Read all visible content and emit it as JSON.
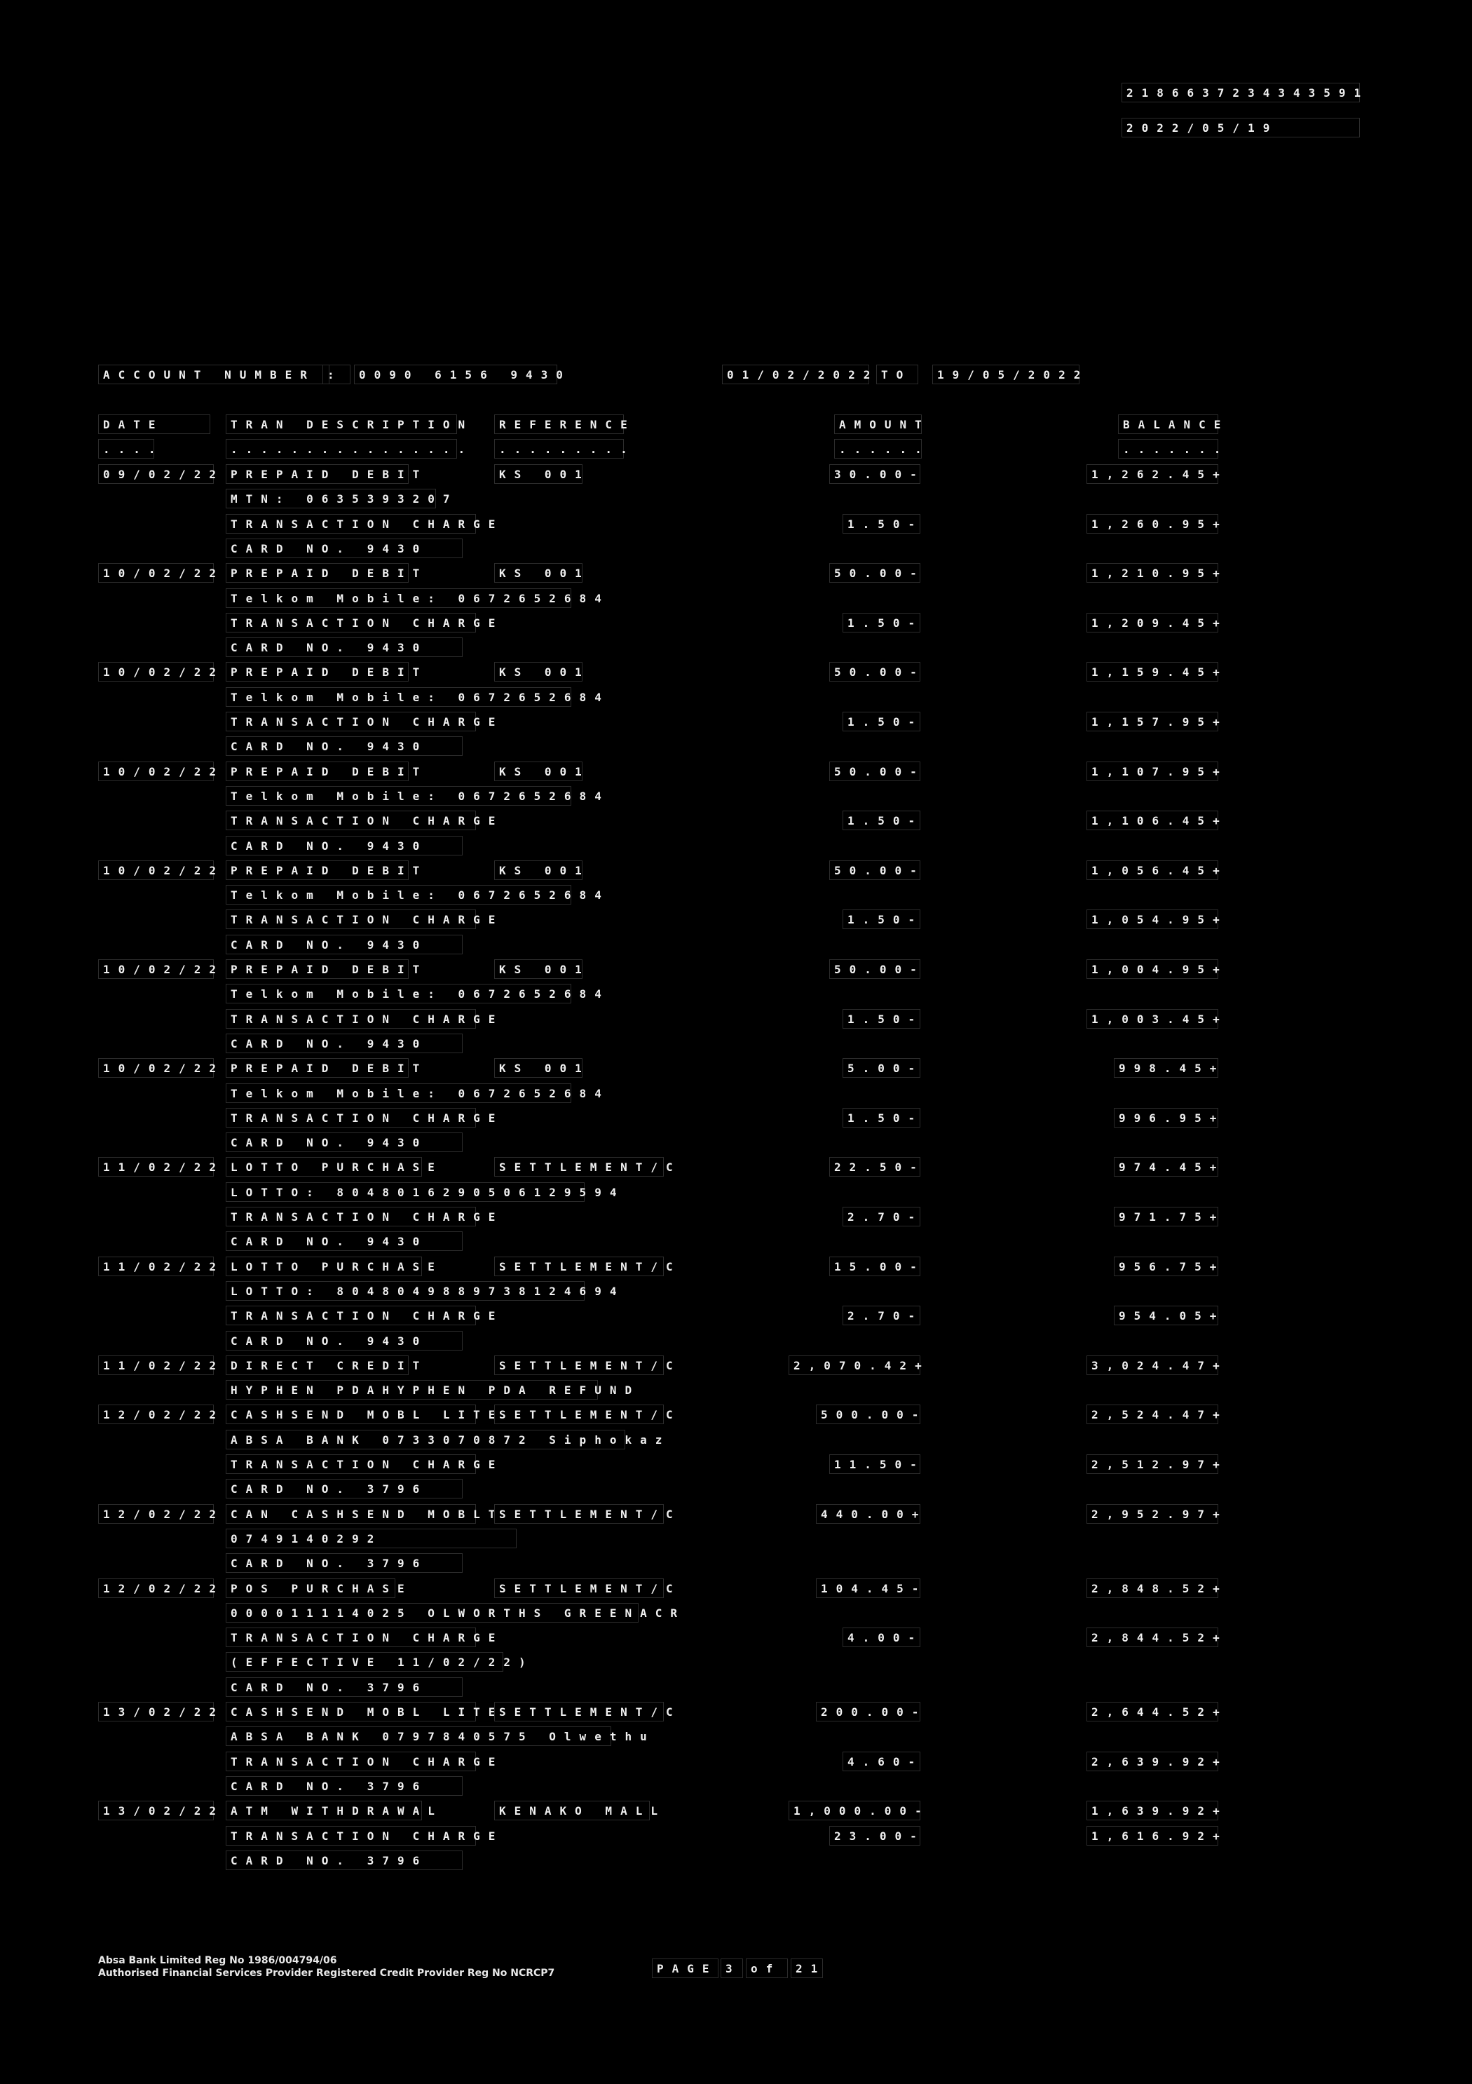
{
  "header": {
    "reference_number": "2186637234343591",
    "statement_date": "2022/05/19"
  },
  "account": {
    "label": "ACCOUNT NUMBER",
    "separator": ":",
    "number": "0090 6156 9430",
    "period_from": "01/02/2022",
    "period_to_label": "TO",
    "period_to": "19/05/2022"
  },
  "columns": {
    "date": "DATE",
    "description": "TRAN DESCRIPTION",
    "reference": "REFERENCE",
    "amount": "AMOUNT",
    "balance": "BALANCE",
    "date_underline": "....",
    "description_underline": "................",
    "reference_underline": ".........",
    "amount_underline": "......",
    "balance_underline": "......."
  },
  "rows": [
    {
      "date": "09/02/22",
      "desc": "PREPAID DEBIT",
      "ref": "KS 001",
      "amount": "30.00-",
      "balance": "1,262.45+"
    },
    {
      "date": "",
      "desc": "MTN: 0635393207",
      "ref": "",
      "amount": "",
      "balance": ""
    },
    {
      "date": "",
      "desc": "TRANSACTION CHARGE",
      "ref": "",
      "amount": "1.50-",
      "balance": "1,260.95+"
    },
    {
      "date": "",
      "desc": "CARD NO.     9430",
      "ref": "",
      "amount": "",
      "balance": ""
    },
    {
      "date": "10/02/22",
      "desc": "PREPAID DEBIT",
      "ref": "KS 001",
      "amount": "50.00-",
      "balance": "1,210.95+"
    },
    {
      "date": "",
      "desc": "Telkom Mobile: 0672652684",
      "ref": "",
      "amount": "",
      "balance": ""
    },
    {
      "date": "",
      "desc": "TRANSACTION CHARGE",
      "ref": "",
      "amount": "1.50-",
      "balance": "1,209.45+"
    },
    {
      "date": "",
      "desc": "CARD NO.     9430",
      "ref": "",
      "amount": "",
      "balance": ""
    },
    {
      "date": "10/02/22",
      "desc": "PREPAID DEBIT",
      "ref": "KS 001",
      "amount": "50.00-",
      "balance": "1,159.45+"
    },
    {
      "date": "",
      "desc": "Telkom Mobile: 0672652684",
      "ref": "",
      "amount": "",
      "balance": ""
    },
    {
      "date": "",
      "desc": "TRANSACTION CHARGE",
      "ref": "",
      "amount": "1.50-",
      "balance": "1,157.95+"
    },
    {
      "date": "",
      "desc": "CARD NO.     9430",
      "ref": "",
      "amount": "",
      "balance": ""
    },
    {
      "date": "10/02/22",
      "desc": "PREPAID DEBIT",
      "ref": "KS 001",
      "amount": "50.00-",
      "balance": "1,107.95+"
    },
    {
      "date": "",
      "desc": "Telkom Mobile: 0672652684",
      "ref": "",
      "amount": "",
      "balance": ""
    },
    {
      "date": "",
      "desc": "TRANSACTION CHARGE",
      "ref": "",
      "amount": "1.50-",
      "balance": "1,106.45+"
    },
    {
      "date": "",
      "desc": "CARD NO.     9430",
      "ref": "",
      "amount": "",
      "balance": ""
    },
    {
      "date": "10/02/22",
      "desc": "PREPAID DEBIT",
      "ref": "KS 001",
      "amount": "50.00-",
      "balance": "1,056.45+"
    },
    {
      "date": "",
      "desc": "Telkom Mobile: 0672652684",
      "ref": "",
      "amount": "",
      "balance": ""
    },
    {
      "date": "",
      "desc": "TRANSACTION CHARGE",
      "ref": "",
      "amount": "1.50-",
      "balance": "1,054.95+"
    },
    {
      "date": "",
      "desc": "CARD NO.     9430",
      "ref": "",
      "amount": "",
      "balance": ""
    },
    {
      "date": "10/02/22",
      "desc": "PREPAID DEBIT",
      "ref": "KS 001",
      "amount": "50.00-",
      "balance": "1,004.95+"
    },
    {
      "date": "",
      "desc": "Telkom Mobile: 0672652684",
      "ref": "",
      "amount": "",
      "balance": ""
    },
    {
      "date": "",
      "desc": "TRANSACTION CHARGE",
      "ref": "",
      "amount": "1.50-",
      "balance": "1,003.45+"
    },
    {
      "date": "",
      "desc": "CARD NO.     9430",
      "ref": "",
      "amount": "",
      "balance": ""
    },
    {
      "date": "10/02/22",
      "desc": "PREPAID DEBIT",
      "ref": "KS 001",
      "amount": "5.00-",
      "balance": "998.45+"
    },
    {
      "date": "",
      "desc": "Telkom Mobile: 0672652684",
      "ref": "",
      "amount": "",
      "balance": ""
    },
    {
      "date": "",
      "desc": "TRANSACTION CHARGE",
      "ref": "",
      "amount": "1.50-",
      "balance": "996.95+"
    },
    {
      "date": "",
      "desc": "CARD NO.     9430",
      "ref": "",
      "amount": "",
      "balance": ""
    },
    {
      "date": "11/02/22",
      "desc": "LOTTO PURCHASE",
      "ref": "SETTLEMENT/C",
      "amount": "22.50-",
      "balance": "974.45+"
    },
    {
      "date": "",
      "desc": "LOTTO: 8048016290506129594",
      "ref": "",
      "amount": "",
      "balance": ""
    },
    {
      "date": "",
      "desc": "TRANSACTION CHARGE",
      "ref": "",
      "amount": "2.70-",
      "balance": "971.75+"
    },
    {
      "date": "",
      "desc": "CARD NO.     9430",
      "ref": "",
      "amount": "",
      "balance": ""
    },
    {
      "date": "11/02/22",
      "desc": "LOTTO PURCHASE",
      "ref": "SETTLEMENT/C",
      "amount": "15.00-",
      "balance": "956.75+"
    },
    {
      "date": "",
      "desc": "LOTTO: 8048049889738124694",
      "ref": "",
      "amount": "",
      "balance": ""
    },
    {
      "date": "",
      "desc": "TRANSACTION CHARGE",
      "ref": "",
      "amount": "2.70-",
      "balance": "954.05+"
    },
    {
      "date": "",
      "desc": "CARD NO.     9430",
      "ref": "",
      "amount": "",
      "balance": ""
    },
    {
      "date": "11/02/22",
      "desc": "DIRECT CREDIT",
      "ref": "SETTLEMENT/C",
      "amount": "2,070.42+",
      "balance": "3,024.47+"
    },
    {
      "date": "",
      "desc": "HYPHEN PDAHYPHEN PDA REFUND",
      "ref": "",
      "amount": "",
      "balance": ""
    },
    {
      "date": "12/02/22",
      "desc": "CASHSEND MOBL LITE",
      "ref": "SETTLEMENT/C",
      "amount": "500.00-",
      "balance": "2,524.47+"
    },
    {
      "date": "",
      "desc": "ABSA BANK 0733070872 Siphokaz",
      "ref": "",
      "amount": "",
      "balance": ""
    },
    {
      "date": "",
      "desc": "TRANSACTION CHARGE",
      "ref": "",
      "amount": "11.50-",
      "balance": "2,512.97+"
    },
    {
      "date": "",
      "desc": "CARD NO.     3796",
      "ref": "",
      "amount": "",
      "balance": ""
    },
    {
      "date": "12/02/22",
      "desc": "CAN CASHSEND MOBLT",
      "ref": "SETTLEMENT/C",
      "amount": "440.00+",
      "balance": "2,952.97+"
    },
    {
      "date": "",
      "desc": "           0749140292",
      "ref": "",
      "amount": "",
      "balance": ""
    },
    {
      "date": "",
      "desc": "CARD NO.     3796",
      "ref": "",
      "amount": "",
      "balance": ""
    },
    {
      "date": "12/02/22",
      "desc": "POS PURCHASE",
      "ref": "SETTLEMENT/C",
      "amount": "104.45-",
      "balance": "2,848.52+"
    },
    {
      "date": "",
      "desc": "000011114025 OLWORTHS GREENACR",
      "ref": "",
      "amount": "",
      "balance": ""
    },
    {
      "date": "",
      "desc": "TRANSACTION CHARGE",
      "ref": "",
      "amount": "4.00-",
      "balance": "2,844.52+"
    },
    {
      "date": "",
      "desc": "(EFFECTIVE 11/02/22)",
      "ref": "",
      "amount": "",
      "balance": ""
    },
    {
      "date": "",
      "desc": "CARD NO.     3796",
      "ref": "",
      "amount": "",
      "balance": ""
    },
    {
      "date": "13/02/22",
      "desc": "CASHSEND MOBL LITE",
      "ref": "SETTLEMENT/C",
      "amount": "200.00-",
      "balance": "2,644.52+"
    },
    {
      "date": "",
      "desc": "ABSA BANK 0797840575 Olwethu",
      "ref": "",
      "amount": "",
      "balance": ""
    },
    {
      "date": "",
      "desc": "TRANSACTION CHARGE",
      "ref": "",
      "amount": "4.60-",
      "balance": "2,639.92+"
    },
    {
      "date": "",
      "desc": "CARD NO.     3796",
      "ref": "",
      "amount": "",
      "balance": ""
    },
    {
      "date": "13/02/22",
      "desc": "ATM WITHDRAWAL",
      "ref": "KENAKO MALL",
      "amount": "1,000.00-",
      "balance": "1,639.92+"
    },
    {
      "date": "",
      "desc": "TRANSACTION CHARGE",
      "ref": "",
      "amount": "23.00-",
      "balance": "1,616.92+"
    },
    {
      "date": "",
      "desc": "CARD NO.     3796",
      "ref": "",
      "amount": "",
      "balance": ""
    }
  ],
  "footer": {
    "line1": "Absa Bank Limited Reg No 1986/004794/06",
    "line2": "Authorised Financial Services Provider Registered Credit Provider Reg No NCRCP7",
    "page_label": "PAGE",
    "page_current": "3",
    "page_of": "of",
    "page_total": "21"
  }
}
